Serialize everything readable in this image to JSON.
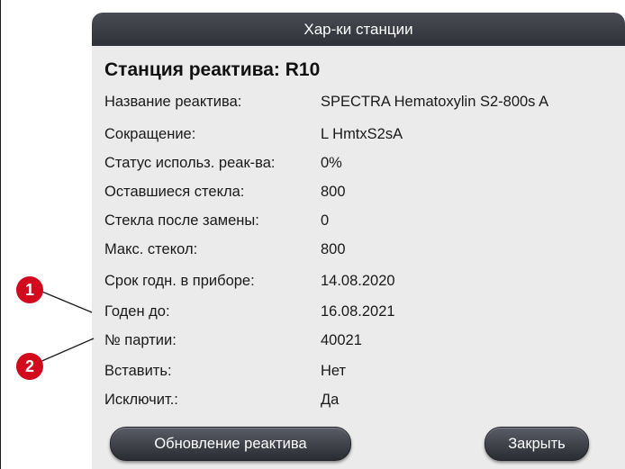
{
  "dialog": {
    "title": "Хар-ки станции",
    "heading": "Станция реактива: R10",
    "fields": [
      {
        "label": "Название реактива:",
        "value": "SPECTRA Hematoxylin S2-800s A"
      },
      {
        "label": "Сокращение:",
        "value": "L HmtxS2sA"
      },
      {
        "label": "Статус использ. реак-ва:",
        "value": "0%"
      },
      {
        "label": "Оставшиеся стекла:",
        "value": "800"
      },
      {
        "label": "Стекла после замены:",
        "value": "0"
      },
      {
        "label": "Макс. стекол:",
        "value": "800"
      },
      {
        "label": "Срок годн. в приборе:",
        "value": "14.08.2020"
      },
      {
        "label": "Годен до:",
        "value": "16.08.2021"
      },
      {
        "label": "№ партии:",
        "value": "40021"
      },
      {
        "label": "Вставить:",
        "value": "Нет"
      },
      {
        "label": "Исключит.:",
        "value": "Да"
      }
    ],
    "buttons": {
      "update_label": "Обновление реактива",
      "close_label": "Закрыть"
    }
  },
  "callouts": [
    "1",
    "2"
  ],
  "colors": {
    "titlebar": "#2f3138",
    "dialog_bg": "#ebebeb",
    "callout": "#d10a1d"
  }
}
